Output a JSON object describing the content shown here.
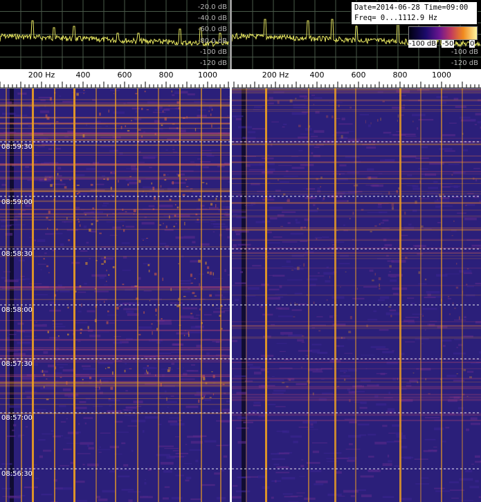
{
  "header": {
    "date_line": "Date=2014-06-28 Time=09:00",
    "freq_line": "Freq= 0...1112.9 Hz"
  },
  "colorbar": {
    "min_label": "-100 dB",
    "mid_label": "-50",
    "max_label": "0"
  },
  "spectrum": {
    "db_labels": [
      "-20.0 dB",
      "-40.0 dB",
      "-60.0 dB",
      "-80.0 dB",
      "-100 dB",
      "-120 dB"
    ],
    "trace_color": "#e8e860"
  },
  "frequency_axis": {
    "ticks": [
      "200 Hz",
      "400",
      "600",
      "800",
      "1000"
    ]
  },
  "time_labels": [
    "08:59:30",
    "08:59:00",
    "08:58:30",
    "08:58:00",
    "08:57:30",
    "08:57:00",
    "08:56:30"
  ],
  "colors": {
    "background": "#2a1a6e",
    "hot": "#f0a020",
    "warm": "#c84080",
    "grid": "#ffffff"
  }
}
